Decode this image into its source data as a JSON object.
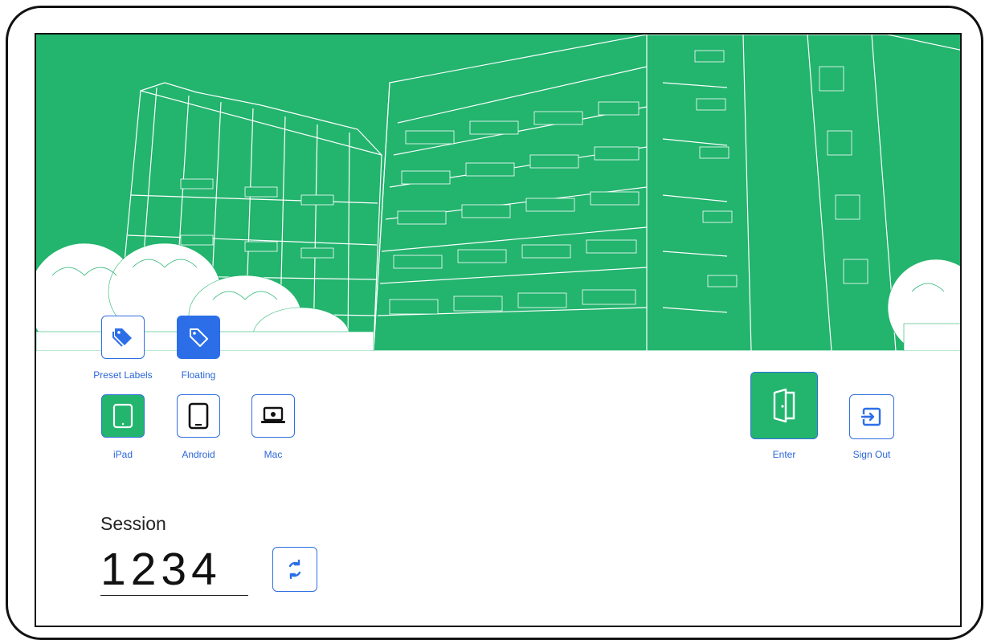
{
  "labels_section": {
    "preset_labels": "Preset Labels",
    "floating": "Floating"
  },
  "devices": {
    "ipad": "iPad",
    "android": "Android",
    "mac": "Mac"
  },
  "actions": {
    "enter": "Enter",
    "sign_out": "Sign Out"
  },
  "session": {
    "title": "Session",
    "code": "1234"
  },
  "icons": {
    "preset_labels": "tags-icon",
    "floating": "tag-icon",
    "ipad": "tablet-icon",
    "android": "tablet-icon",
    "mac": "laptop-icon",
    "enter": "door-open-icon",
    "sign_out": "sign-in-arrow-icon",
    "refresh": "refresh-icon"
  },
  "colors": {
    "accent_green": "#23b46e",
    "accent_blue": "#2c6ee8",
    "label_blue": "#2a66d8"
  }
}
